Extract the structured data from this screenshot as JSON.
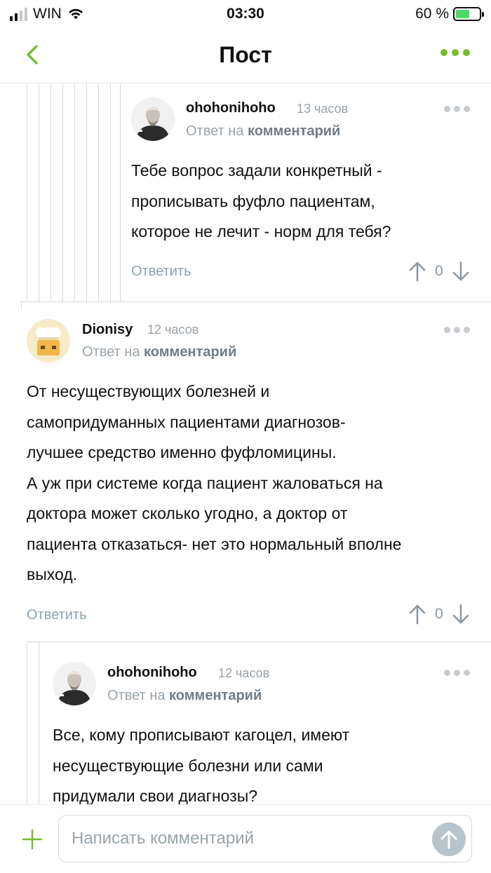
{
  "status_bar": {
    "carrier": "WIN",
    "time": "03:30",
    "battery_text": "60 %"
  },
  "header": {
    "title": "Пост",
    "back_icon": "chevron-left-icon",
    "more_icon": "more-horizontal-icon"
  },
  "colors": {
    "accent": "#79bc2f",
    "muted": "#9aa3a9",
    "link": "#8ea2ae"
  },
  "comments": [
    {
      "username": "ohohonihoho",
      "time": "13 часов",
      "reply_prefix": "Ответ на",
      "reply_link": "комментарий",
      "lines": [
        "Тебе вопрос задали конкретный -",
        "прописывать фуфло пациентам,",
        "которое не лечит - норм для тебя?"
      ],
      "reply_label": "Ответить",
      "rating": "0"
    },
    {
      "username": "Dionisy",
      "time": "12 часов",
      "reply_prefix": "Ответ на",
      "reply_link": "комментарий",
      "lines": [
        "От несуществующих болезней и",
        "самопридуманных пациентами диагнозов-",
        "лучшее средство именно фуфломицины.",
        "А уж при системе когда пациент жаловаться на",
        "доктора может сколько угодно, а доктор от",
        "пациента отказаться- нет это нормальный вполне",
        "выход."
      ],
      "reply_label": "Ответить",
      "rating": "0"
    },
    {
      "username": "ohohonihoho",
      "time": "12 часов",
      "reply_prefix": "Ответ на",
      "reply_link": "комментарий",
      "lines": [
        "Все, кому прописывают кагоцел, имеют",
        "несуществующие болезни или сами",
        "придумали свои диагнозы?"
      ]
    }
  ],
  "composer": {
    "placeholder": "Написать комментарий",
    "plus_icon": "plus-icon",
    "send_icon": "arrow-up-icon"
  }
}
